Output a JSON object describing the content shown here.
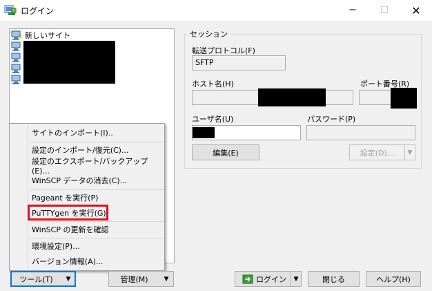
{
  "window": {
    "title": "ログイン",
    "minimize_glyph": "─",
    "maximize_glyph": "☐",
    "close_glyph": "✕"
  },
  "site_tree": {
    "new_site_label": "新しいサイト"
  },
  "session": {
    "legend": "セッション",
    "protocol_label": "転送プロトコル(F)",
    "protocol_value": "SFTP",
    "host_label": "ホスト名(H)",
    "port_label": "ポート番号(R)",
    "user_label": "ユーザ名(U)",
    "password_label": "パスワード(P)",
    "edit_button": "編集(E)",
    "settings_button": "設定(D)..."
  },
  "tools_menu": {
    "items": [
      "サイトのインポート(I)..",
      "設定のインポート/復元(C)...",
      "設定のエクスポート/バックアップ(E)...",
      "WinSCP データの消去(C)...",
      "Pageant を実行(P)",
      "PuTTYgen を実行(G)",
      "WinSCP の更新を確認",
      "環境設定(P)...",
      "バージョン情報(A)..."
    ]
  },
  "bottom_bar": {
    "tools_button": "ツール(T)",
    "manage_button": "管理(M)",
    "login_button": "ログイン",
    "close_button": "閉じる",
    "help_button": "ヘルプ(H)"
  },
  "colors": {
    "highlight": "#e0101f",
    "focus": "#0078d7"
  }
}
